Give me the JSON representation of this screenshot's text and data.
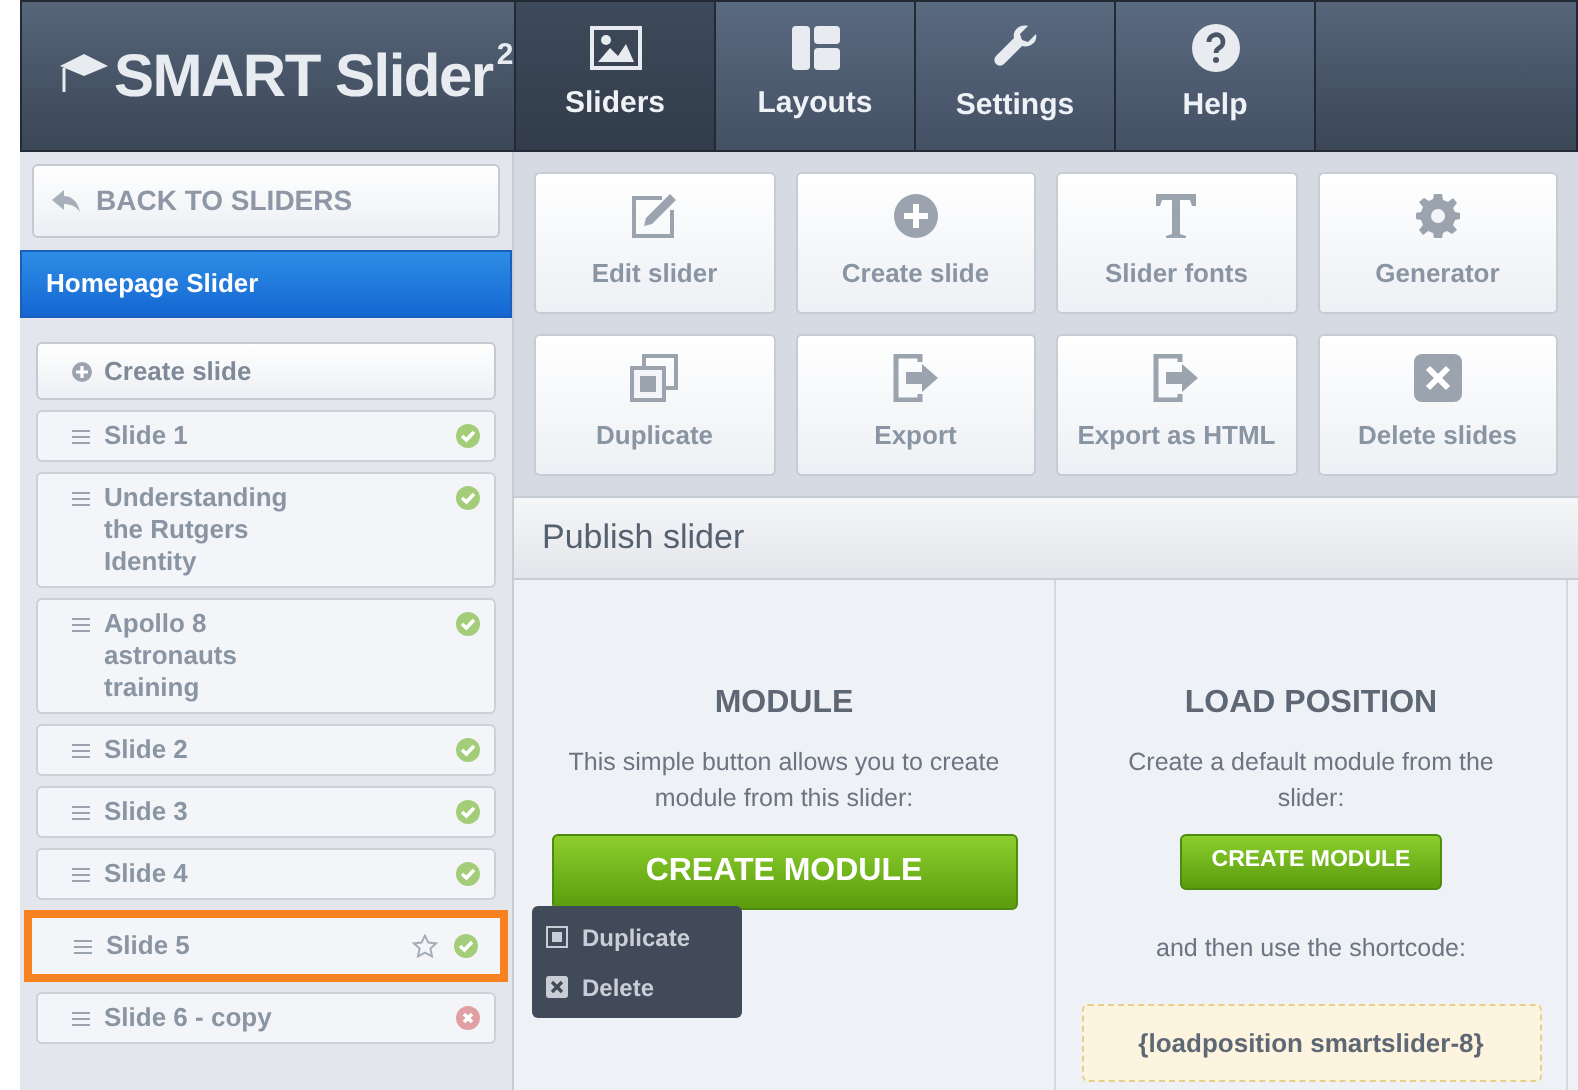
{
  "logo": {
    "text": "SMART Slider",
    "sup": "2"
  },
  "nav": [
    {
      "label": "Sliders",
      "kind": "image",
      "selected": true
    },
    {
      "label": "Layouts",
      "kind": "layout",
      "selected": false
    },
    {
      "label": "Settings",
      "kind": "wrench",
      "selected": false
    },
    {
      "label": "Help",
      "kind": "help",
      "selected": false
    }
  ],
  "sidebar": {
    "back_button": "BACK TO SLIDERS",
    "slider_title": "Homepage Slider",
    "create_button": "Create slide",
    "slides": [
      {
        "title": "Slide 1",
        "published": true,
        "selected": false
      },
      {
        "title": "Understanding the Rutgers Identity",
        "published": true,
        "selected": false
      },
      {
        "title": "Apollo 8 astronauts training",
        "published": true,
        "selected": false
      },
      {
        "title": "Slide 2",
        "published": true,
        "selected": false
      },
      {
        "title": "Slide 3",
        "published": true,
        "selected": false
      },
      {
        "title": "Slide 4",
        "published": true,
        "selected": false
      },
      {
        "title": "Slide 5",
        "published": true,
        "selected": true
      },
      {
        "title": "Slide 6 - copy",
        "published": false,
        "selected": false
      }
    ],
    "context_menu": [
      {
        "label": "Duplicate",
        "kind": "duplicate"
      },
      {
        "label": "Delete",
        "kind": "delete"
      }
    ]
  },
  "actions": [
    {
      "label": "Edit slider",
      "kind": "edit"
    },
    {
      "label": "Create slide",
      "kind": "plus"
    },
    {
      "label": "Slider fonts",
      "kind": "font"
    },
    {
      "label": "Generator",
      "kind": "gear"
    },
    {
      "label": "Duplicate",
      "kind": "copy"
    },
    {
      "label": "Export",
      "kind": "export"
    },
    {
      "label": "Export as HTML",
      "kind": "export"
    },
    {
      "label": "Delete slides",
      "kind": "delete"
    }
  ],
  "publish": {
    "title": "Publish slider",
    "module": {
      "heading": "MODULE",
      "text": "This simple button allows you to create module from this slider:",
      "button": "CREATE MODULE"
    },
    "load_position": {
      "heading": "LOAD POSITION",
      "text": "Create a default module from the slider:",
      "button": "CREATE MODULE",
      "note": "and then use the shortcode:",
      "shortcode": "{loadposition smartslider-8}"
    }
  }
}
